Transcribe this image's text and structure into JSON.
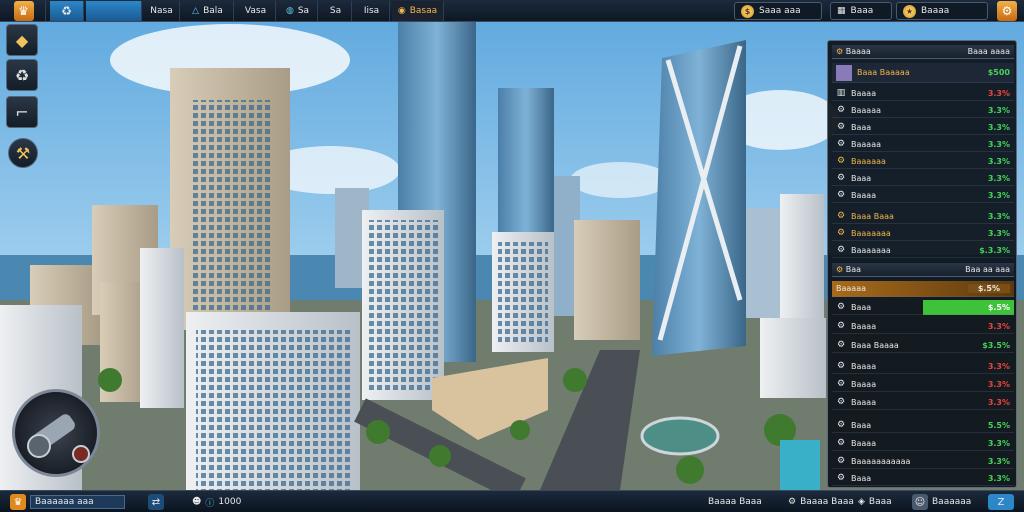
{
  "colors": {
    "accent_blue": "#2c87c9",
    "accent_orange": "#e08a1e",
    "positive": "#47d35a",
    "negative": "#e8453c",
    "panel_bg": "#0c121a"
  },
  "topbar": {
    "home_icon": "crown-icon",
    "swap_icon": "recycle-icon",
    "tabs": [
      {
        "label": "Nasa",
        "icon": ""
      },
      {
        "label": "Bala",
        "icon": "triangle-icon"
      },
      {
        "label": "Vasa",
        "icon": ""
      },
      {
        "label": "Sa",
        "icon": "globe-icon"
      },
      {
        "label": "Sa",
        "icon": ""
      },
      {
        "label": "Iisa",
        "icon": ""
      },
      {
        "label": "Basaa",
        "icon": "coin-icon"
      }
    ],
    "money_label": "Saaa aaa",
    "date_label": "Baaa",
    "rank_label": "Baaaa",
    "settings_icon": "gear-icon"
  },
  "tools": [
    {
      "name": "build-tool",
      "icon": "cube-icon"
    },
    {
      "name": "zone-tool",
      "icon": "recycle-icon"
    },
    {
      "name": "road-tool",
      "icon": "crane-icon"
    },
    {
      "name": "bulldoze-tool",
      "icon": "hammer-icon"
    }
  ],
  "panel": {
    "header_left": "Baaaa",
    "header_right": "Baaa aaaa",
    "featured": {
      "label": "Baaa Baaaaa",
      "value": "$500"
    },
    "rows": [
      {
        "icon": "bars-icon",
        "label": "Baaaa",
        "value": "3.3%",
        "trend": "down"
      },
      {
        "icon": "gear-icon",
        "label": "Baaaaa",
        "value": "3.3%",
        "trend": "up"
      },
      {
        "icon": "gear-icon",
        "label": "Baaa",
        "value": "3.3%",
        "trend": "up"
      },
      {
        "icon": "gear-icon",
        "label": "Baaaaa",
        "value": "3.3%",
        "trend": "up"
      },
      {
        "icon": "gear-icon",
        "label": "Baaaaaa",
        "value": "3.3%",
        "trend": "up",
        "gold": true
      },
      {
        "icon": "gear-icon",
        "label": "Baaa",
        "value": "3.3%",
        "trend": "up"
      },
      {
        "icon": "gear-icon",
        "label": "Baaaa",
        "value": "3.3%",
        "trend": "up"
      },
      {
        "icon": "gear-icon",
        "label": "Baaa Baaa",
        "value": "3.3%",
        "trend": "up",
        "gold": true
      },
      {
        "icon": "gear-icon",
        "label": "Baaaaaaa",
        "value": "3.3%",
        "trend": "up",
        "gold": true
      },
      {
        "icon": "gear-icon",
        "label": "Baaaaaaa",
        "value": "$.3.3%",
        "trend": "up"
      }
    ],
    "section2_left": "Baa",
    "section2_right": "Baa aa aaa",
    "budget": {
      "label": "Baaaaa",
      "value": "$.5%"
    },
    "budget_fill": 0.6,
    "rows2": [
      {
        "icon": "gear-icon",
        "label": "Baaa",
        "value": "$.5%",
        "trend": "up",
        "highlight": true
      },
      {
        "icon": "gear-icon",
        "label": "Baaaa",
        "value": "3.3%",
        "trend": "down"
      },
      {
        "icon": "gear-icon",
        "label": "Baaa Baaaa",
        "value": "$3.5%",
        "trend": "up"
      },
      {
        "icon": "gear-icon",
        "label": "Baaaa",
        "value": "3.3%",
        "trend": "down"
      },
      {
        "icon": "gear-icon",
        "label": "Baaaa",
        "value": "3.3%",
        "trend": "down"
      },
      {
        "icon": "gear-icon",
        "label": "Baaaa",
        "value": "3.3%",
        "trend": "down"
      },
      {
        "icon": "gear-icon",
        "label": "Baaa",
        "value": "5.5%",
        "trend": "up"
      },
      {
        "icon": "gear-icon",
        "label": "Baaaa",
        "value": "3.3%",
        "trend": "up"
      },
      {
        "icon": "gear-icon",
        "label": "Baaaaaaaaaaa",
        "value": "3.3%",
        "trend": "up"
      },
      {
        "icon": "gear-icon",
        "label": "Baaa",
        "value": "3.3%",
        "trend": "up"
      }
    ]
  },
  "bottombar": {
    "city_name": "Baaaaaa aaa",
    "population": "1000",
    "speed_label": "Baaaa Baaa",
    "stats_label": "Baaaa Baaa",
    "alerts_label": "Baaa",
    "mode_label": "Baaaaaa"
  }
}
